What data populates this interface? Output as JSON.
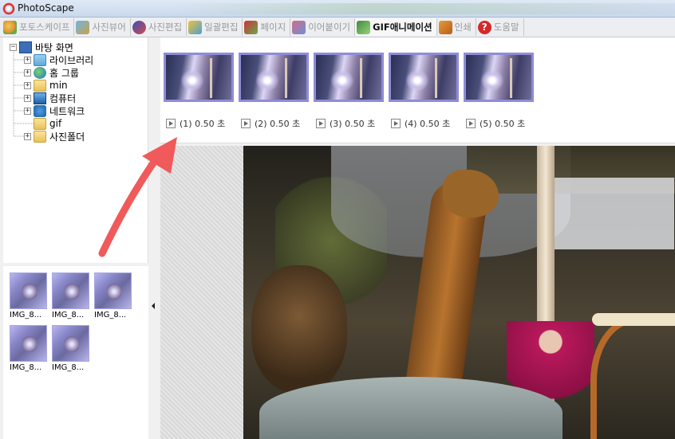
{
  "window": {
    "title": "PhotoScape"
  },
  "tabs": [
    {
      "label": "포토스케이프",
      "icon": "photoscape-icon",
      "active": false
    },
    {
      "label": "사진뷰어",
      "icon": "viewer-icon",
      "active": false
    },
    {
      "label": "사진편집",
      "icon": "editor-icon",
      "active": false
    },
    {
      "label": "일괄편집",
      "icon": "batch-editor-icon",
      "active": false
    },
    {
      "label": "페이지",
      "icon": "page-icon",
      "active": false
    },
    {
      "label": "이어붙이기",
      "icon": "combine-icon",
      "active": false
    },
    {
      "label": "GIF애니메이션",
      "icon": "gif-animation-icon",
      "active": true
    },
    {
      "label": "인쇄",
      "icon": "print-icon",
      "active": false
    },
    {
      "label": "도움말",
      "icon": "help-icon",
      "active": false
    }
  ],
  "tree": {
    "root": "바탕 화면",
    "items": [
      {
        "label": "라이브러리",
        "icon": "library-icon"
      },
      {
        "label": "홈 그룹",
        "icon": "homegroup-icon"
      },
      {
        "label": "min",
        "icon": "user-folder-icon"
      },
      {
        "label": "컴퓨터",
        "icon": "computer-icon"
      },
      {
        "label": "네트워크",
        "icon": "network-icon"
      },
      {
        "label": "gif",
        "icon": "folder-icon"
      },
      {
        "label": "사진폴더",
        "icon": "folder-icon"
      }
    ]
  },
  "thumbnails": [
    {
      "caption": "IMG_8..."
    },
    {
      "caption": "IMG_8..."
    },
    {
      "caption": "IMG_8..."
    },
    {
      "caption": "IMG_8..."
    },
    {
      "caption": "IMG_8..."
    }
  ],
  "frames": [
    {
      "label": "(1) 0.50 초"
    },
    {
      "label": "(2) 0.50 초"
    },
    {
      "label": "(3) 0.50 초"
    },
    {
      "label": "(4) 0.50 초"
    },
    {
      "label": "(5) 0.50 초"
    }
  ],
  "colors": {
    "frame_border": "#8f8cd8",
    "annotation_arrow": "#f05a5a"
  }
}
